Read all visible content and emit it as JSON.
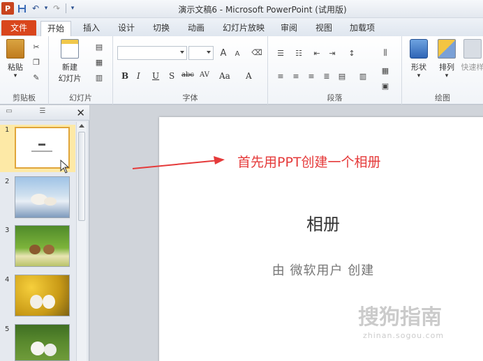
{
  "window": {
    "title": "演示文稿6 - Microsoft PowerPoint (试用版)"
  },
  "qat": {
    "logo": "P",
    "undo": "↶",
    "redo": "↷",
    "more": "▾"
  },
  "tabs": [
    {
      "label": "文件"
    },
    {
      "label": "开始"
    },
    {
      "label": "插入"
    },
    {
      "label": "设计"
    },
    {
      "label": "切换"
    },
    {
      "label": "动画"
    },
    {
      "label": "幻灯片放映"
    },
    {
      "label": "审阅"
    },
    {
      "label": "视图"
    },
    {
      "label": "加载项"
    }
  ],
  "ribbon": {
    "clipboard": {
      "paste": "粘贴",
      "label": "剪贴板"
    },
    "slides": {
      "new_slide": "新建",
      "new_slide2": "幻灯片",
      "label": "幻灯片"
    },
    "font": {
      "label": "字体",
      "bold": "B",
      "italic": "I",
      "underline": "U",
      "strike": "S",
      "abc": "abc",
      "av": "AV",
      "aa": "Aa",
      "a": "A",
      "grow": "A",
      "shrink": "A"
    },
    "paragraph": {
      "label": "段落"
    },
    "drawing": {
      "shape": "形状",
      "arrange": "排列",
      "quick": "快速样",
      "label": "绘图"
    }
  },
  "panel": {
    "close": "✕",
    "slides": [
      {
        "num": "1"
      },
      {
        "num": "2"
      },
      {
        "num": "3"
      },
      {
        "num": "4"
      },
      {
        "num": "5"
      }
    ]
  },
  "slide": {
    "title": "相册",
    "subtitle": "由 微软用户 创建"
  },
  "annotation": {
    "text": "首先用PPT创建一个相册"
  },
  "watermark": {
    "brand": "搜狗指南",
    "url": "zhinan.sogou.com"
  },
  "colors": {
    "accent": "#d9461c",
    "annotation": "#e53a3a"
  }
}
